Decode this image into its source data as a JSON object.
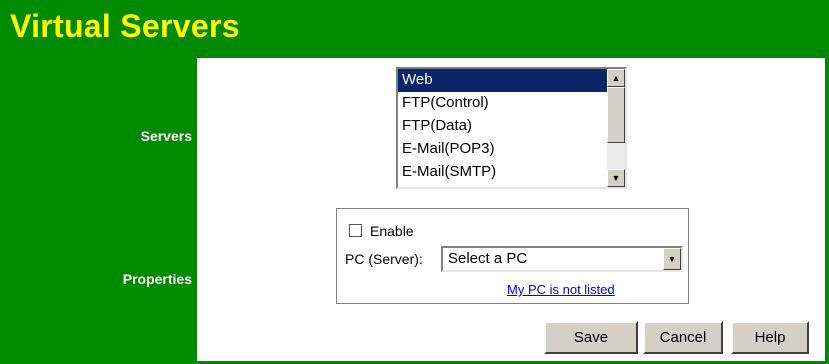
{
  "page": {
    "title": "Virtual Servers"
  },
  "labels": {
    "servers": "Servers",
    "properties": "Properties"
  },
  "servers": {
    "items": [
      "Web",
      "FTP(Control)",
      "FTP(Data)",
      "E-Mail(POP3)",
      "E-Mail(SMTP)"
    ],
    "selected": "Web"
  },
  "properties": {
    "enable_label": "Enable",
    "enabled": false,
    "pc_label": "PC (Server):",
    "pc_selected": "Select a PC",
    "pc_not_listed_link": "My PC is not listed"
  },
  "buttons": {
    "save": "Save",
    "cancel": "Cancel",
    "help": "Help"
  },
  "colors": {
    "frame_green": "#008a00",
    "title_yellow": "#ffff00",
    "selection_blue": "#0a246a"
  }
}
